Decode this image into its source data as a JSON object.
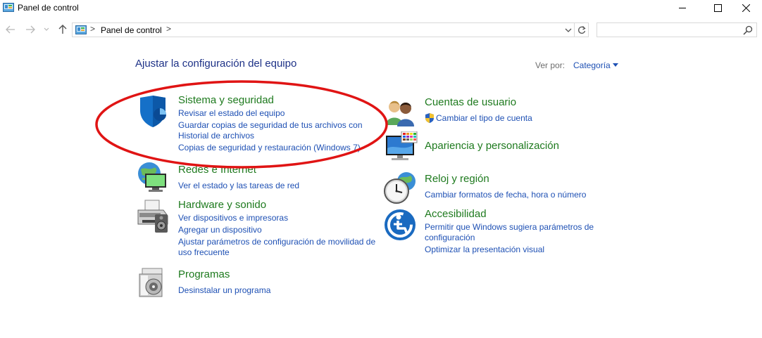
{
  "window": {
    "title": "Panel de control"
  },
  "address": {
    "separator": ">",
    "crumb": "Panel de control",
    "search_placeholder": ""
  },
  "main": {
    "heading": "Ajustar la configuración del equipo",
    "view_by_label": "Ver por:",
    "view_by_value": "Categoría"
  },
  "categories": {
    "system": {
      "title": "Sistema y seguridad",
      "links": [
        "Revisar el estado del equipo",
        "Guardar copias de seguridad de tus archivos con",
        "Historial de archivos",
        "Copias de seguridad y restauración (Windows 7)"
      ]
    },
    "network": {
      "title": "Redes e Internet",
      "links": [
        "Ver el estado y las tareas de red"
      ]
    },
    "hardware": {
      "title": "Hardware y sonido",
      "links": [
        "Ver dispositivos e impresoras",
        "Agregar un dispositivo",
        "Ajustar parámetros de configuración de movilidad de",
        "uso frecuente"
      ]
    },
    "programs": {
      "title": "Programas",
      "links": [
        "Desinstalar un programa"
      ]
    },
    "accounts": {
      "title": "Cuentas de usuario",
      "links": [
        "Cambiar el tipo de cuenta"
      ]
    },
    "appearance": {
      "title": "Apariencia y personalización"
    },
    "clock": {
      "title": "Reloj y región",
      "links": [
        "Cambiar formatos de fecha, hora o número"
      ]
    },
    "access": {
      "title": "Accesibilidad",
      "links": [
        "Permitir que Windows sugiera parámetros de",
        "configuración",
        "Optimizar la presentación visual"
      ]
    }
  },
  "colors": {
    "heading": "#1e3287",
    "category_title": "#1e7a1e",
    "link": "#1e50b4",
    "annotation_oval": "#e01414"
  },
  "icons": [
    "control-panel-icon",
    "minimize-icon",
    "maximize-icon",
    "close-icon",
    "back-arrow-icon",
    "forward-arrow-icon",
    "recent-dropdown-icon",
    "up-arrow-icon",
    "refresh-icon",
    "search-icon",
    "shield-icon",
    "network-globe-icon",
    "printer-icon",
    "programs-disc-icon",
    "users-icon",
    "uac-shield-icon",
    "monitor-palette-icon",
    "clock-globe-icon",
    "accessibility-icon"
  ]
}
